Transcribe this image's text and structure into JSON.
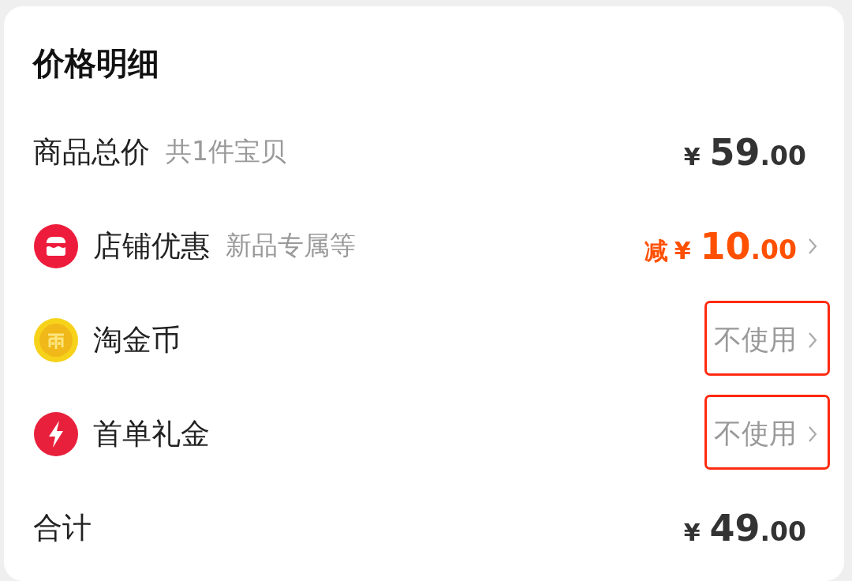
{
  "title": "价格明细",
  "rows": [
    {
      "kind": "plain",
      "label": "商品总价",
      "note": "共1件宝贝",
      "value": {
        "kind": "amount",
        "currency": "¥",
        "integer": "59",
        "decimal": ".00"
      },
      "chevron": false,
      "highlighted": false
    },
    {
      "kind": "store",
      "label": "店铺优惠",
      "note": "新品专属等",
      "value": {
        "kind": "discount",
        "prefix": "减",
        "currency": "¥",
        "integer": "10",
        "decimal": ".00"
      },
      "chevron": true,
      "highlighted": false
    },
    {
      "kind": "coin",
      "label": "淘金币",
      "value": {
        "kind": "text",
        "text": "不使用"
      },
      "chevron": true,
      "highlighted": true
    },
    {
      "kind": "bolt",
      "label": "首单礼金",
      "value": {
        "kind": "text",
        "text": "不使用"
      },
      "chevron": true,
      "highlighted": true
    },
    {
      "kind": "plain",
      "label": "合计",
      "value": {
        "kind": "amount",
        "currency": "¥",
        "integer": "49",
        "decimal": ".00"
      },
      "chevron": false,
      "highlighted": false
    }
  ]
}
